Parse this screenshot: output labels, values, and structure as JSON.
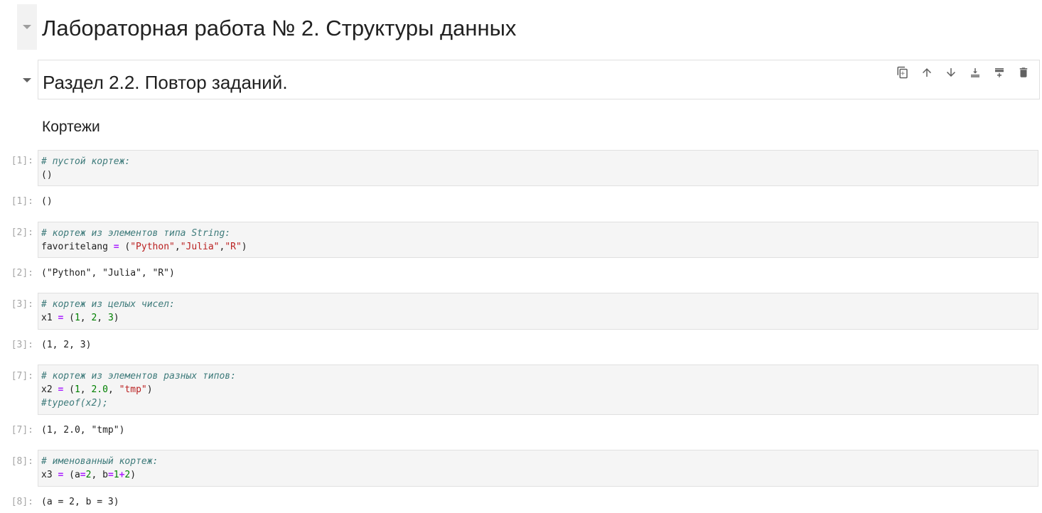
{
  "notebook": {
    "title": "Лабораторная работа № 2. Структуры данных",
    "section": "Раздел 2.2. Повтор заданий.",
    "subsection": "Кортежи"
  },
  "toolbar": {
    "icons": [
      "duplicate-icon",
      "move-up-icon",
      "move-down-icon",
      "insert-below-icon",
      "insert-above-icon",
      "delete-icon"
    ]
  },
  "cells": [
    {
      "prompt": "[1]:",
      "out_prompt": "[1]:",
      "comment": "# пустой кортеж:",
      "code": "()",
      "output": "()"
    },
    {
      "prompt": "[2]:",
      "out_prompt": "[2]:",
      "comment": "# кортеж из элементов типа String:",
      "code_parts": {
        "var": "favoritelang ",
        "eq": "=",
        "open": " (",
        "s1": "\"Python\"",
        "c1": ",",
        "s2": "\"Julia\"",
        "c2": ",",
        "s3": "\"R\"",
        "close": ")"
      },
      "output": "(\"Python\", \"Julia\", \"R\")"
    },
    {
      "prompt": "[3]:",
      "out_prompt": "[3]:",
      "comment": "# кортеж из целых чисел:",
      "code_parts": {
        "var": "x1 ",
        "eq": "=",
        "open": " (",
        "n1": "1",
        "c1": ", ",
        "n2": "2",
        "c2": ", ",
        "n3": "3",
        "close": ")"
      },
      "output": "(1, 2, 3)"
    },
    {
      "prompt": "[7]:",
      "out_prompt": "[7]:",
      "comment": "# кортеж из элементов разных типов:",
      "code_parts": {
        "var": "x2 ",
        "eq": "=",
        "open": " (",
        "n1": "1",
        "c1": ", ",
        "n2": "2.0",
        "c2": ", ",
        "s1": "\"tmp\"",
        "close": ")"
      },
      "comment2": "#typeof(x2);",
      "output": "(1, 2.0, \"tmp\")"
    },
    {
      "prompt": "[8]:",
      "out_prompt": "[8]:",
      "comment": "# именованный кортеж:",
      "code_parts": {
        "var": "x3 ",
        "eq": "=",
        "open": " (a",
        "eq2": "=",
        "n1": "2",
        "c1": ", b",
        "eq3": "=",
        "n2": "1",
        "plus": "+",
        "n3": "2",
        "close": ")"
      },
      "output": "(a = 2, b = 3)"
    }
  ]
}
